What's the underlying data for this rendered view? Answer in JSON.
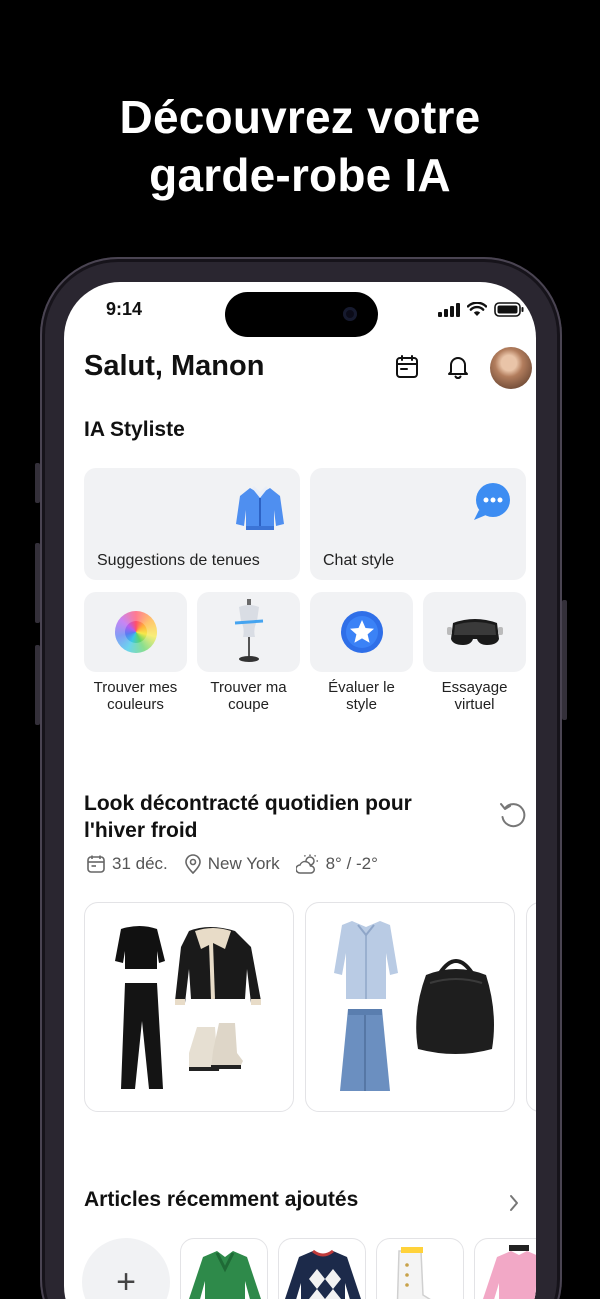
{
  "promo": {
    "headline_line1": "Découvrez votre",
    "headline_line2": "garde-robe IA"
  },
  "status_bar": {
    "time": "9:14"
  },
  "header": {
    "greeting": "Salut, Manon"
  },
  "ai_stylist": {
    "title": "IA Styliste",
    "big_cards": [
      {
        "label": "Suggestions de tenues",
        "icon": "jacket-icon"
      },
      {
        "label": "Chat style",
        "icon": "chat-bubble-icon"
      }
    ],
    "tools": [
      {
        "line1": "Trouver mes",
        "line2": "couleurs",
        "icon": "color-wheel-icon"
      },
      {
        "line1": "Trouver ma",
        "line2": "coupe",
        "icon": "mannequin-icon"
      },
      {
        "line1": "Évaluer le",
        "line2": "style",
        "icon": "star-badge-icon"
      },
      {
        "line1": "Essayage",
        "line2": "virtuel",
        "icon": "vr-headset-icon"
      }
    ]
  },
  "look": {
    "title": "Look décontracté quotidien pour l'hiver froid",
    "date": "31 déc.",
    "location": "New York",
    "weather": "8° / -2°"
  },
  "recent": {
    "title": "Articles récemment ajoutés",
    "add_label": "+"
  },
  "colors": {
    "accent_blue": "#2f6fe8",
    "card_bg": "#f1f2f4"
  }
}
